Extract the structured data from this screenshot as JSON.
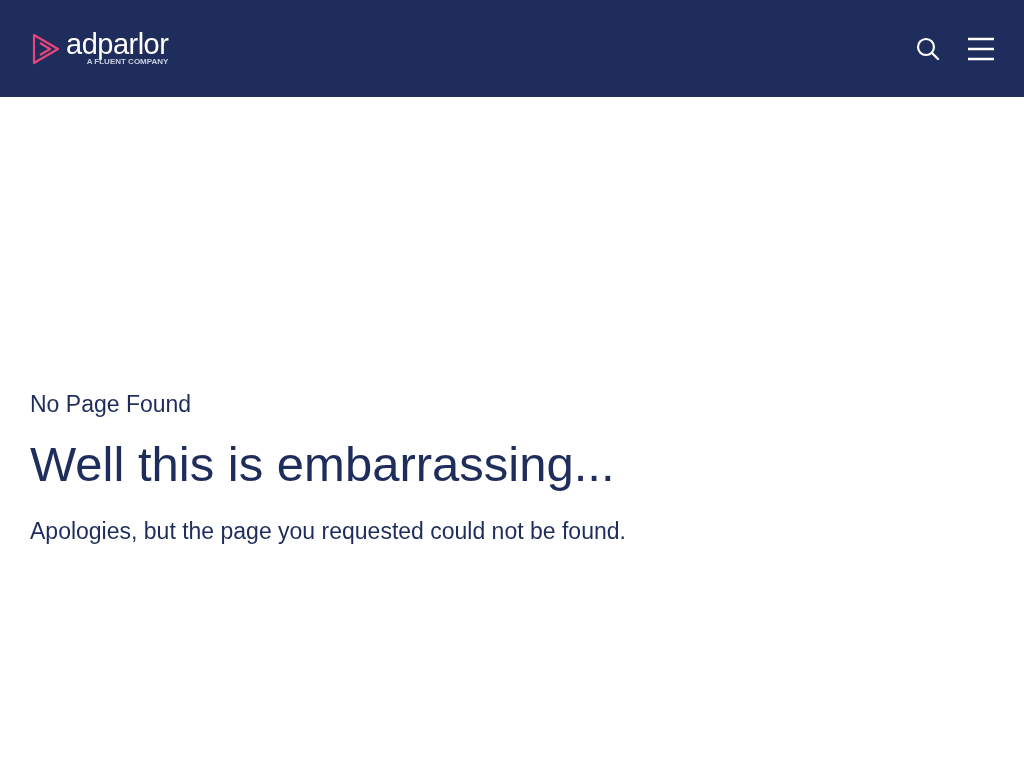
{
  "header": {
    "logo": {
      "name": "adparlor",
      "tagline": "A FLUENT COMPANY"
    }
  },
  "content": {
    "eyebrow": "No Page Found",
    "title": "Well this is embarrassing...",
    "message": "Apologies, but the page you requested could not be found."
  }
}
